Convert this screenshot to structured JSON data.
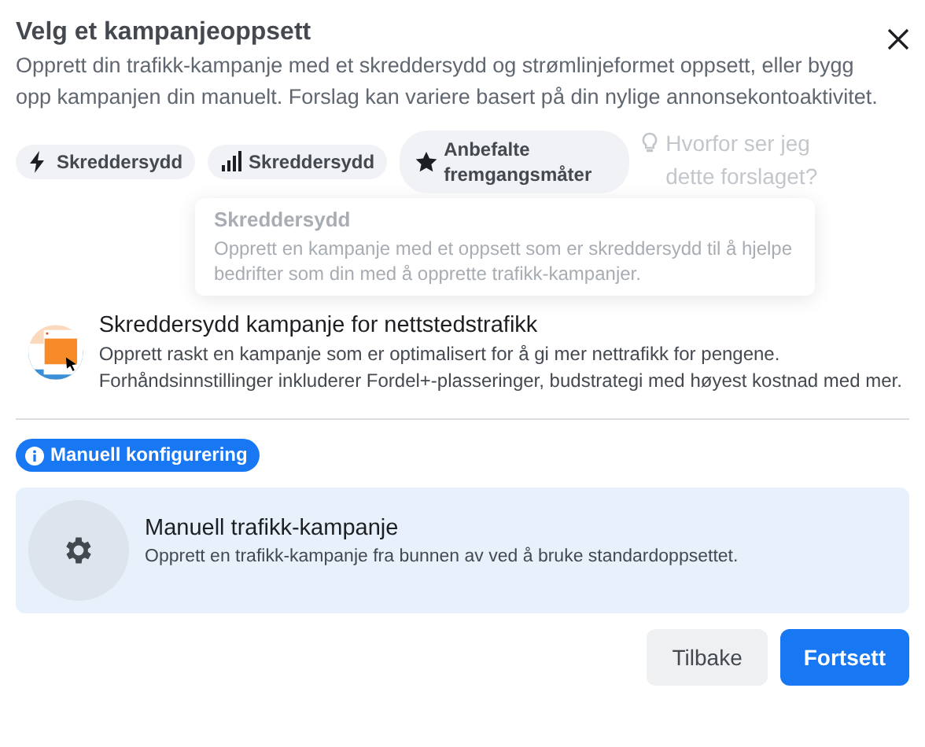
{
  "dialog": {
    "title": "Velg et kampanjeoppsett",
    "description": "Opprett din trafikk-kampanje med et skreddersydd og strømlinjeformet oppsett, eller bygg opp kampanjen din manuelt. Forslag kan variere basert på din nylige annonsekontoaktivitet."
  },
  "chips": [
    {
      "kind": "bolt",
      "label": "Skreddersydd"
    },
    {
      "kind": "bars",
      "label": "Skreddersydd"
    },
    {
      "kind": "star",
      "label": "Anbefalte fremgangsmåter"
    }
  ],
  "hint": "Hvorfor ser jeg dette forslaget?",
  "suggested_option": {
    "title": "Skreddersydd kampanje for nettstedstrafikk",
    "description": "Opprett raskt en kampanje som er optimalisert for å gi mer nettrafikk for pengene. Forhåndsinnstillinger inkluderer Fordel+-plasseringer, budstrategi med høyest kostnad med mer."
  },
  "tooltip": {
    "title": "Skreddersydd",
    "text": "Opprett en kampanje med et oppsett som er skreddersydd til å hjelpe bedrifter som din med å opprette trafikk-kampanjer."
  },
  "manual_badge": "Manuell konfigurering",
  "manual_option": {
    "title": "Manuell trafikk-kampanje",
    "description": "Opprett en trafikk-kampanje fra bunnen av ved å bruke standardoppsettet.",
    "selected": true
  },
  "buttons": [
    {
      "kind": "secondary",
      "label": "Tilbake"
    },
    {
      "kind": "primary",
      "label": "Fortsett"
    }
  ]
}
